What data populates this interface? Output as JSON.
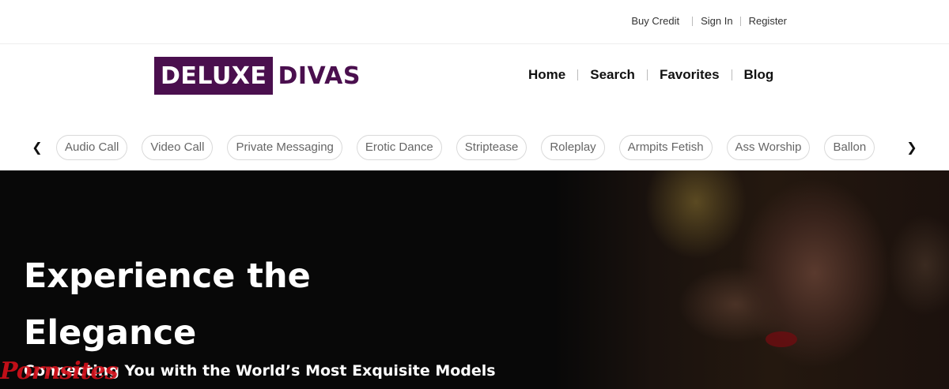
{
  "utility_nav": {
    "buy_credit": "Buy Credit",
    "sign_in": "Sign In",
    "register": "Register"
  },
  "logo": {
    "part1": "DELUXE",
    "part2": "DIVAS",
    "brand_color": "#4a0f4e"
  },
  "main_nav": {
    "items": [
      {
        "label": "Home"
      },
      {
        "label": "Search"
      },
      {
        "label": "Favorites"
      },
      {
        "label": "Blog"
      }
    ]
  },
  "categories": {
    "prev_icon": "chevron-left-icon",
    "next_icon": "chevron-right-icon",
    "items": [
      {
        "label": "Audio Call"
      },
      {
        "label": "Video Call"
      },
      {
        "label": "Private Messaging"
      },
      {
        "label": "Erotic Dance"
      },
      {
        "label": "Striptease"
      },
      {
        "label": "Roleplay"
      },
      {
        "label": "Armpits Fetish"
      },
      {
        "label": "Ass Worship"
      },
      {
        "label": "Ballon"
      }
    ]
  },
  "hero": {
    "title": "Experience the Elegance",
    "subtitle": "Connecting You with the World’s Most Exquisite Models"
  },
  "watermark": {
    "text": "Pornsites",
    "color": "#d0101a"
  }
}
